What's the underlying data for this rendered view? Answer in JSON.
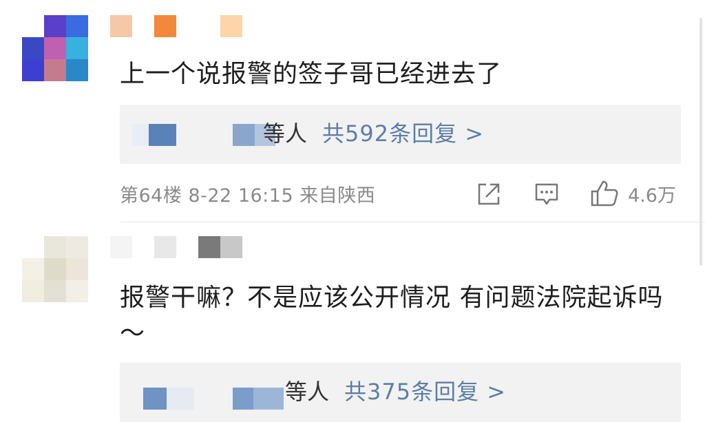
{
  "comments": [
    {
      "text": "上一个说报警的签子哥已经进去了",
      "reply": {
        "people_suffix": "等人",
        "count_label": "共592条回复 >"
      },
      "floor": "第64楼",
      "time": "8-22 16:15",
      "location": "来自陕西",
      "likes": "4.6万",
      "avatar_colors": [
        "#ffffff",
        "#5a3fc8",
        "#3a6be0",
        "#3b48c4",
        "#c060b0",
        "#38b0e0",
        "#3d3fd0",
        "#c47b8e",
        "#2a88c8"
      ],
      "name_colors": [
        "#f6c8a8",
        "#ffffff",
        "#f3883c",
        "#ffffff",
        "#ffffff",
        "#fdd5a8"
      ]
    },
    {
      "text": "报警干嘛？不是应该公开情况 有问题法院起诉吗～",
      "reply": {
        "people_suffix": "等人",
        "count_label": "共375条回复 >"
      },
      "avatar_colors": [
        "#ffffff",
        "#e9e6dc",
        "#eeeae2",
        "#f4f0e6",
        "#dedbc9",
        "#ebe6d9",
        "#f1ede1",
        "#e3e0d4",
        "#f3efe6"
      ],
      "name_colors": [
        "#f4f4f4",
        "#ffffff",
        "#e8e8e8",
        "#ffffff",
        "#7a7a7a",
        "#c8c8c8"
      ]
    }
  ],
  "icons": [
    "share-icon",
    "comment-icon",
    "like-icon"
  ]
}
